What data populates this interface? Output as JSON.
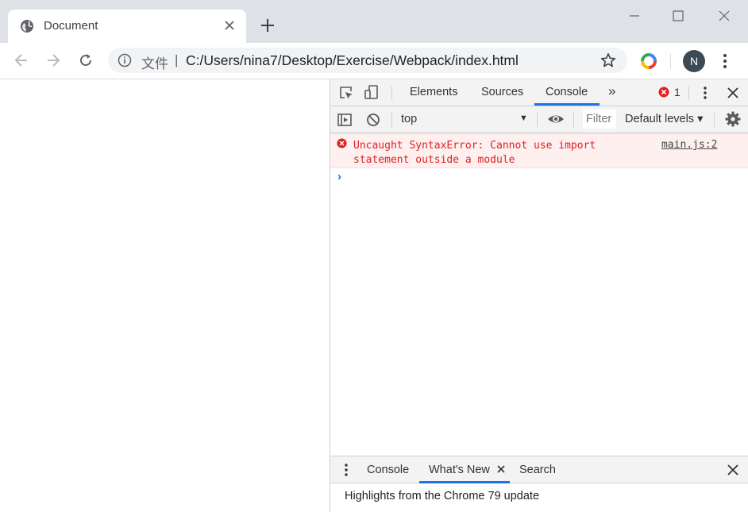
{
  "browser": {
    "tab": {
      "title": "Document"
    },
    "omnibox": {
      "label": "文件",
      "separator": "|",
      "url": "C:/Users/nina7/Desktop/Exercise/Webpack/index.html"
    },
    "profile_initial": "N"
  },
  "devtools": {
    "tabs": [
      "Elements",
      "Sources",
      "Console"
    ],
    "active_tab": "Console",
    "more_tabs_glyph": "»",
    "error_count": "1",
    "toolbar": {
      "context": "top",
      "filter_placeholder": "Filter",
      "levels": "Default levels ▾"
    },
    "console": {
      "messages": [
        {
          "level": "error",
          "text": "Uncaught SyntaxError: Cannot use import statement outside a module",
          "source": "main.js:2"
        }
      ],
      "prompt_glyph": "›"
    },
    "drawer": {
      "tabs": [
        "Console",
        "What's New",
        "Search"
      ],
      "active_tab": "What's New",
      "content": "Highlights from the Chrome 79 update"
    }
  },
  "colors": {
    "accent": "#1a73e8",
    "error": "#e02020",
    "error_bg": "#fff0f0",
    "titlebar": "#dee1e6"
  }
}
